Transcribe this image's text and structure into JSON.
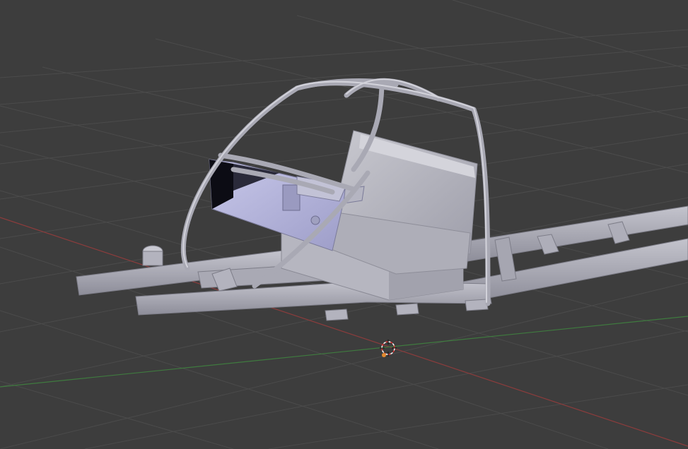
{
  "viewport": {
    "mode": "3d-viewport",
    "background_color": "#3d3d3d",
    "grid_line_color": "#4a4a4a",
    "x_axis_color": "#8c3c3c",
    "y_axis_color": "#3f7a3f",
    "cursor_icon": "3d-cursor-icon",
    "object_icon": "vehicle-chassis-mesh",
    "mesh_color": "#b9b9c4",
    "mesh_shadow_color": "#8f8f9c",
    "mesh_highlight_color": "#d6d6de"
  }
}
